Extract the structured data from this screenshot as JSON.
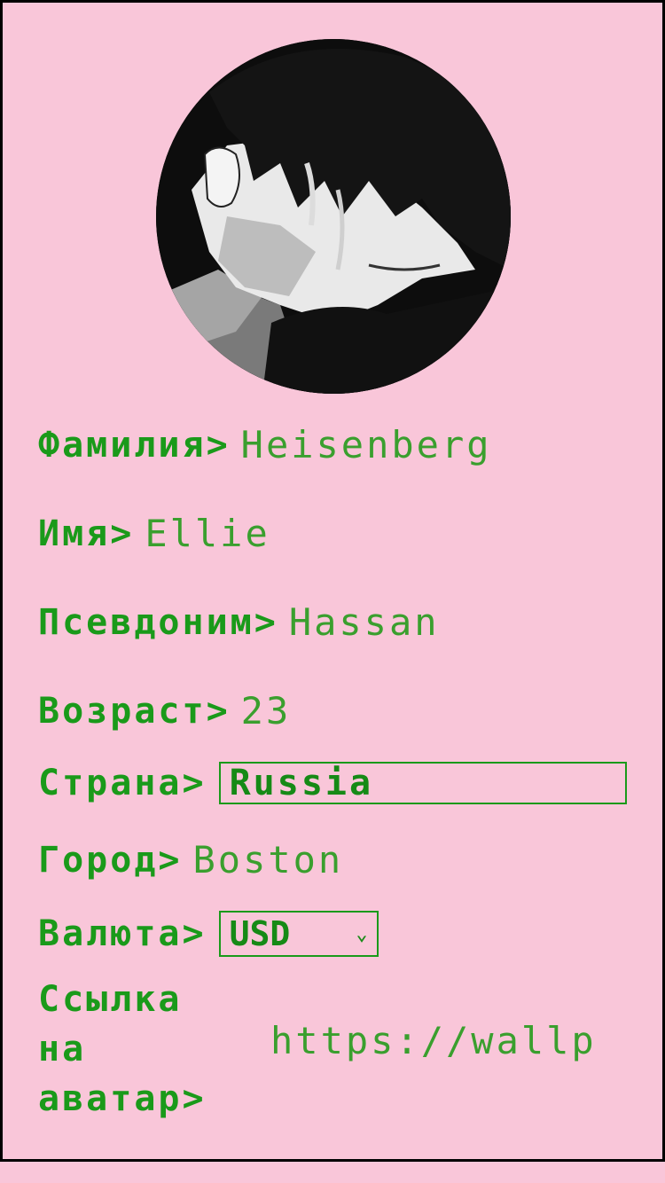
{
  "profile": {
    "avatar_icon": "anime-portrait-avatar",
    "fields": {
      "surname": {
        "label": "Фамилия>",
        "value": "Heisenberg"
      },
      "name": {
        "label": "Имя>",
        "value": "Ellie"
      },
      "nickname": {
        "label": "Псевдоним>",
        "value": "Hassan"
      },
      "age": {
        "label": "Возраст>",
        "value": "23"
      },
      "country": {
        "label": "Страна>",
        "value": "Russia"
      },
      "city": {
        "label": "Город>",
        "value": "Boston"
      },
      "currency": {
        "label": "Валюта>",
        "value": "USD"
      },
      "avatar_link": {
        "label_lines": [
          "Ссылка",
          "на",
          "аватар>"
        ],
        "value": "https://wallp"
      }
    }
  },
  "colors": {
    "background": "#f9c6d9",
    "label_green": "#1a9a1a",
    "value_green": "#3a9f2e",
    "border": "#000000"
  }
}
